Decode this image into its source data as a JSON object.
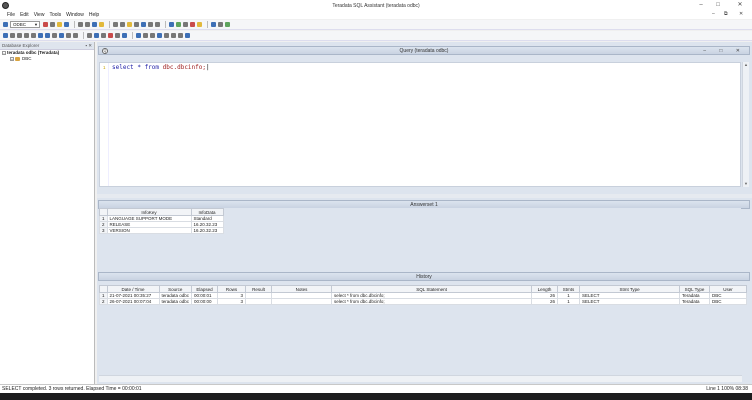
{
  "window": {
    "title": "Teradata SQL Assistant (teradata odbc)",
    "controls": {
      "minimize": "–",
      "maximize": "□",
      "close": "✕"
    }
  },
  "menu": {
    "items": [
      "File",
      "Edit",
      "View",
      "Tools",
      "Window",
      "Help"
    ],
    "right": {
      "minimize": "–",
      "restore": "⧉",
      "close": "✕"
    }
  },
  "toolbar": {
    "connection": "ODBC"
  },
  "explorer": {
    "title": "Database Explorer",
    "pins": "▪ ✕",
    "root": "teradata odbc (Teradata)",
    "child": "DBC"
  },
  "query": {
    "title": "Query (teradata odbc)",
    "line_number": "1",
    "keyword_select": "select",
    "op": "*",
    "keyword_from": "from",
    "table": "dbc.dbcinfo;",
    "controls": "– □ ✕"
  },
  "answerset": {
    "title": "Answerset 1",
    "columns": [
      "InfoKey",
      "InfoData"
    ],
    "rows": [
      {
        "n": "1",
        "c1": "LANGUAGE SUPPORT MODE",
        "c2": "Standard"
      },
      {
        "n": "2",
        "c1": "RELEASE",
        "c2": "16.20.32.23"
      },
      {
        "n": "3",
        "c1": "VERSION",
        "c2": "16.20.32.23"
      }
    ]
  },
  "history": {
    "title": "History",
    "columns": [
      "Date / Time",
      "Source",
      "Elapsed",
      "Rows",
      "Result",
      "Notes",
      "SQL Statement",
      "Length",
      "Stmts",
      "Stmt Type",
      "SQL Type",
      "User"
    ],
    "rows": [
      {
        "n": "1",
        "c1": "21-07-2021 00:35:27",
        "c2": "teradata odbc",
        "c3": "00:00:01",
        "c4": "3",
        "c5": "",
        "c6": "",
        "c7": "select * from dbc.dbcinfo;",
        "c8": "26",
        "c9": "1",
        "c10": "SELECT",
        "c11": "Teradata",
        "c12": "DBC"
      },
      {
        "n": "2",
        "c1": "26-07-2021 00:07:04",
        "c2": "teradata odbc",
        "c3": "00:00:00",
        "c4": "3",
        "c5": "",
        "c6": "",
        "c7": "select * from dbc.dbcinfo;",
        "c8": "26",
        "c9": "1",
        "c10": "SELECT",
        "c11": "Teradata",
        "c12": "DBC"
      }
    ]
  },
  "status": {
    "message": "SELECT completed. 3 rows returned. Elapsed Time = 00:00:01",
    "right": "Line 1  100%  08:38"
  }
}
